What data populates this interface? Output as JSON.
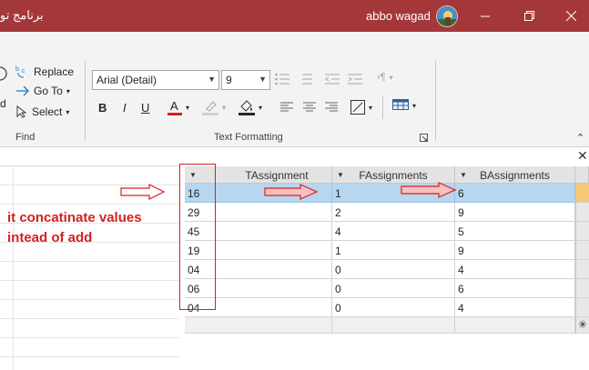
{
  "titlebar": {
    "app_title": "برنامج تو",
    "user_name": "abbo wagad",
    "bg_color": "#a4373a"
  },
  "ribbon": {
    "find": {
      "replace_label": "Replace",
      "goto_label": "Go To",
      "select_label": "Select",
      "group_label": "Find",
      "partial_left_label": "d"
    },
    "text_formatting": {
      "font_name": "Arial (Detail)",
      "font_size": "9",
      "bold": "B",
      "italic": "I",
      "underline": "U",
      "font_color_letter": "A",
      "group_label": "Text Formatting",
      "accent_color": "#d62020",
      "rtl_glyph": "›¶"
    }
  },
  "datasheet": {
    "columns": [
      {
        "label": ""
      },
      {
        "label": "TAssignment"
      },
      {
        "label": "FAssignments"
      },
      {
        "label": "BAssignments"
      }
    ],
    "rows": [
      [
        "16",
        "",
        "1",
        "6"
      ],
      [
        "29",
        "",
        "2",
        "9"
      ],
      [
        "45",
        "",
        "4",
        "5"
      ],
      [
        "19",
        "",
        "1",
        "9"
      ],
      [
        "04",
        "",
        "0",
        "4"
      ],
      [
        "06",
        "",
        "0",
        "6"
      ],
      [
        "04",
        "",
        "0",
        "4"
      ]
    ],
    "selected_row": 0,
    "new_row_marker": "✳"
  },
  "annotation": {
    "line1": "it concatinate values",
    "line2": "intead of add",
    "color": "#d62020"
  }
}
